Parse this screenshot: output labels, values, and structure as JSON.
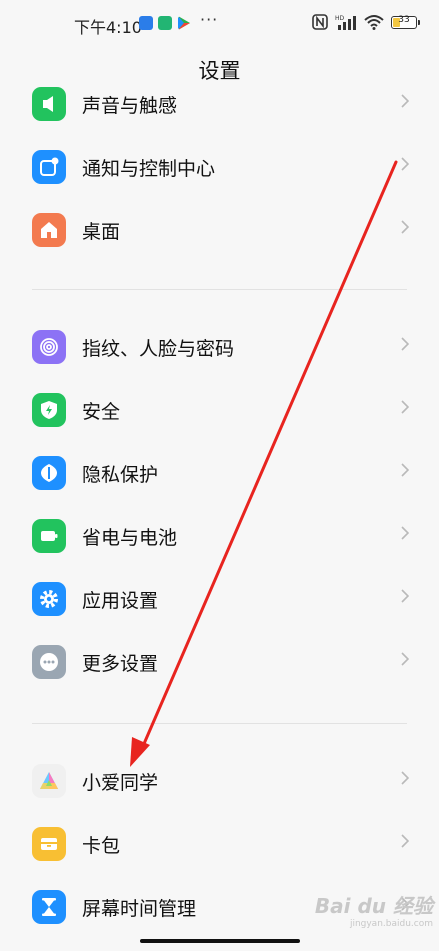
{
  "status_bar": {
    "time": "下午4:10",
    "battery_level": "33",
    "battery_fraction": 0.33,
    "more_indicator": "···",
    "icons": [
      "app-notification-icon",
      "shield-app-icon",
      "play-store-icon",
      "nfc-icon",
      "signal-icon",
      "wifi-icon",
      "battery-icon"
    ]
  },
  "header": {
    "title": "设置"
  },
  "settings": {
    "group_1": [
      {
        "label": "声音与触感",
        "icon": "speaker-icon",
        "color": "#22c35e"
      },
      {
        "label": "通知与控制中心",
        "icon": "notification-icon",
        "color": "#1e90ff"
      },
      {
        "label": "桌面",
        "icon": "home-icon",
        "color": "#f37a4f"
      }
    ],
    "group_2": [
      {
        "label": "指纹、人脸与密码",
        "icon": "fingerprint-icon",
        "color": "#8c72f5"
      },
      {
        "label": "安全",
        "icon": "security-shield-icon",
        "color": "#22c35e"
      },
      {
        "label": "隐私保护",
        "icon": "privacy-icon",
        "color": "#1e90ff"
      },
      {
        "label": "省电与电池",
        "icon": "battery-saver-icon",
        "color": "#22c35e"
      },
      {
        "label": "应用设置",
        "icon": "app-settings-gear-icon",
        "color": "#1e90ff"
      },
      {
        "label": "更多设置",
        "icon": "more-settings-icon",
        "color": "#9aa6b2"
      }
    ],
    "group_3": [
      {
        "label": "小爱同学",
        "icon": "xiaoai-assistant-icon",
        "color": "#f2f2f2"
      },
      {
        "label": "卡包",
        "icon": "wallet-icon",
        "color": "#f8bf33"
      },
      {
        "label": "屏幕时间管理",
        "icon": "hourglass-icon",
        "color": "#1e90ff"
      }
    ]
  },
  "annotation": {
    "arrow_color": "#e8241f"
  },
  "watermark": {
    "logo": "Bai du 经验",
    "url": "jingyan.baidu.com"
  }
}
